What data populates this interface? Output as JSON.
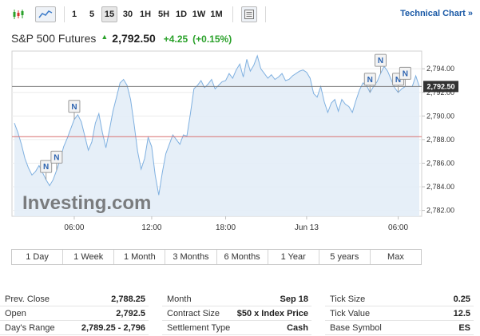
{
  "toolbar": {
    "chart_types": [
      {
        "icon": "candlestick-chart-icon"
      },
      {
        "icon": "area-chart-icon",
        "active": true
      }
    ],
    "intervals": [
      "1",
      "5",
      "15",
      "30",
      "1H",
      "5H",
      "1D",
      "1W",
      "1M"
    ],
    "active_interval": "15",
    "settings_icon": "chart-settings-icon",
    "technical_chart_label": "Technical Chart »"
  },
  "quote": {
    "name": "S&P 500 Futures",
    "direction_icon": "up-arrow-icon",
    "last": "2,792.50",
    "change": "+4.25",
    "change_pct": "(+0.15%)"
  },
  "chart_data": {
    "type": "area",
    "x_tick_labels": [
      "06:00",
      "12:00",
      "18:00",
      "Jun 13",
      "06:00"
    ],
    "y_tick_labels": [
      "2,794.00",
      "2,792.00",
      "2,790.00",
      "2,788.00",
      "2,786.00",
      "2,784.00",
      "2,782.00"
    ],
    "ylim": [
      2781.5,
      2795.5
    ],
    "last_price_label": "2,792.50",
    "last_price": 2792.5,
    "prev_close": 2788.25,
    "grid": true,
    "watermark": "Investing.com",
    "values": [
      2789.4,
      2788.6,
      2787.6,
      2786.4,
      2785.6,
      2785.0,
      2785.3,
      2785.8,
      2785.2,
      2784.6,
      2784.1,
      2784.6,
      2785.4,
      2786.3,
      2787.4,
      2788.1,
      2788.9,
      2789.7,
      2790.1,
      2789.5,
      2788.3,
      2787.1,
      2787.8,
      2789.4,
      2790.2,
      2788.6,
      2787.3,
      2788.8,
      2790.4,
      2791.6,
      2792.8,
      2793.1,
      2792.6,
      2791.4,
      2789.3,
      2787.0,
      2785.5,
      2786.4,
      2788.2,
      2787.4,
      2785.0,
      2783.3,
      2785.2,
      2786.8,
      2787.6,
      2788.4,
      2788.0,
      2787.6,
      2788.4,
      2788.3,
      2790.2,
      2792.3,
      2792.6,
      2793.0,
      2792.4,
      2792.7,
      2793.1,
      2792.3,
      2792.6,
      2792.9,
      2793.0,
      2793.6,
      2793.2,
      2793.9,
      2794.4,
      2793.3,
      2794.8,
      2793.8,
      2794.3,
      2795.1,
      2794.0,
      2793.6,
      2793.2,
      2793.5,
      2793.1,
      2793.3,
      2793.6,
      2793.0,
      2793.1,
      2793.4,
      2793.6,
      2793.8,
      2793.9,
      2793.7,
      2793.2,
      2791.9,
      2791.6,
      2792.5,
      2791.2,
      2790.3,
      2791.1,
      2791.4,
      2790.4,
      2791.4,
      2791.0,
      2790.8,
      2790.3,
      2791.3,
      2792.2,
      2792.8,
      2792.6,
      2792.0,
      2792.5,
      2792.9,
      2793.6,
      2794.2,
      2793.8,
      2793.1,
      2792.4,
      2792.0,
      2792.3,
      2792.5,
      2792.5,
      2792.5,
      2793.4,
      2792.5
    ],
    "news_markers": [
      {
        "label": "N",
        "index": 9
      },
      {
        "label": "N",
        "index": 12
      },
      {
        "label": "N",
        "index": 17
      },
      {
        "label": "N",
        "index": 101
      },
      {
        "label": "N",
        "index": 104
      },
      {
        "label": "N",
        "index": 109
      },
      {
        "label": "N",
        "index": 111
      }
    ]
  },
  "ranges": [
    "1 Day",
    "1 Week",
    "1 Month",
    "3 Months",
    "6 Months",
    "1 Year",
    "5 years",
    "Max"
  ],
  "stats": {
    "col1": [
      {
        "label": "Prev. Close",
        "value": "2,788.25"
      },
      {
        "label": "Open",
        "value": "2,792.5"
      },
      {
        "label": "Day's Range",
        "value": "2,789.25 - 2,796"
      }
    ],
    "col2": [
      {
        "label": "Month",
        "value": "Sep 18"
      },
      {
        "label": "Contract Size",
        "value": "$50 x Index Price"
      },
      {
        "label": "Settlement Type",
        "value": "Cash"
      }
    ],
    "col3": [
      {
        "label": "Tick Size",
        "value": "0.25"
      },
      {
        "label": "Tick Value",
        "value": "12.5"
      },
      {
        "label": "Base Symbol",
        "value": "ES"
      }
    ]
  }
}
